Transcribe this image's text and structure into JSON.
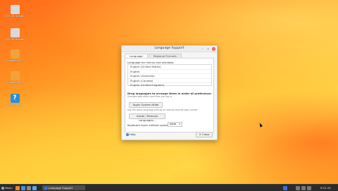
{
  "desktop_icons": [
    {
      "label": "XFE GB Header",
      "color": "#d9d9d9"
    },
    {
      "label": "XFE GB Header",
      "color": "#d9d9d9"
    },
    {
      "label": "Installed XFE",
      "color": "#f0a33a"
    },
    {
      "label": "Installed XFE",
      "color": "#f0a33a"
    },
    {
      "label": "Instructions",
      "color": "#2d8fd5"
    }
  ],
  "window": {
    "title": "Language Support",
    "tabs": [
      "Language",
      "Regional Formats"
    ],
    "language_heading": "Language for menus and windows:",
    "languages": [
      "English (United States)",
      "English",
      "English (Australia)",
      "English (Canada)",
      "English (United Kingdom)"
    ],
    "drag_hint": "Drag languages to arrange them in order of preference.",
    "drag_hint_small": "Changes take effect next time you log in.",
    "apply_system_wide": "Apply System-Wide",
    "apply_note": "Use the same language choices for startup and the login screen.",
    "install_remove": "Install / Remove Languages...",
    "keyboard_label": "Keyboard input method system:",
    "keyboard_value": "none",
    "help": "Help",
    "close": "Close"
  },
  "taskbar": {
    "menu": "Menu",
    "task": "Language Support",
    "clock": "9:12 23"
  }
}
